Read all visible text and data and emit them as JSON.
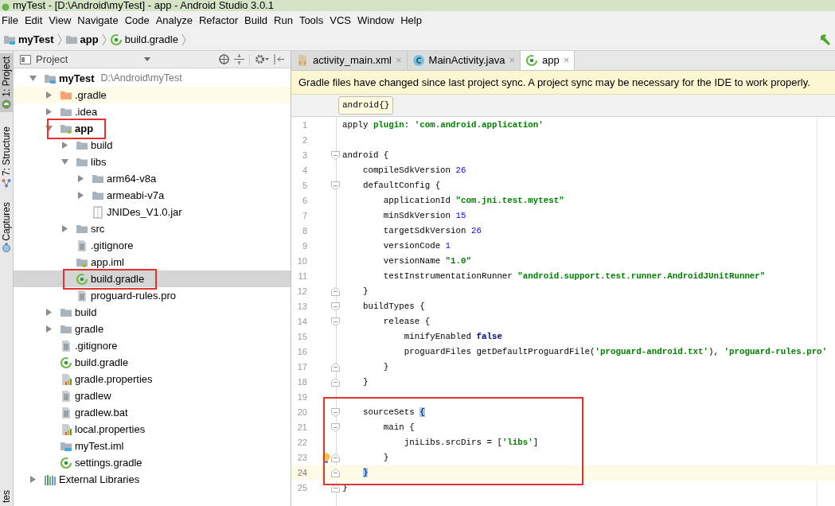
{
  "window": {
    "title": "myTest - [D:\\Android\\myTest] - app - Android Studio 3.0.1"
  },
  "menu": [
    "File",
    "Edit",
    "View",
    "Navigate",
    "Code",
    "Analyze",
    "Refactor",
    "Build",
    "Run",
    "Tools",
    "VCS",
    "Window",
    "Help"
  ],
  "breadcrumbs": [
    "myTest",
    "app",
    "build.gradle"
  ],
  "side_strip": [
    {
      "label": "1: Project",
      "selected": true
    },
    {
      "label": "7: Structure",
      "selected": false
    },
    {
      "label": "Captures",
      "selected": false
    },
    {
      "label": "tes",
      "selected": false
    }
  ],
  "project_panel": {
    "title": "Project",
    "tree": [
      {
        "name": "myTest",
        "hint": "D:\\Android\\myTest",
        "kind": "module",
        "bold": true,
        "expanded": true,
        "selected": false,
        "hovered": false,
        "highlighted": false,
        "children": [
          {
            "name": ".gradle",
            "kind": "folder-orange",
            "bold": false,
            "expanded": false,
            "selected": false,
            "hovered": true,
            "highlighted": false
          },
          {
            "name": ".idea",
            "kind": "folder",
            "bold": false,
            "expanded": false,
            "selected": false,
            "hovered": false,
            "highlighted": false
          },
          {
            "name": "app",
            "kind": "module-folder",
            "bold": true,
            "expanded": true,
            "selected": false,
            "hovered": false,
            "highlighted": true,
            "children": [
              {
                "name": "build",
                "kind": "folder",
                "bold": false,
                "expanded": false,
                "selected": false,
                "hovered": false,
                "highlighted": false
              },
              {
                "name": "libs",
                "kind": "folder",
                "bold": false,
                "expanded": true,
                "selected": false,
                "hovered": false,
                "highlighted": false,
                "children": [
                  {
                    "name": "arm64-v8a",
                    "kind": "folder",
                    "bold": false,
                    "expanded": false,
                    "selected": false,
                    "hovered": false,
                    "highlighted": false
                  },
                  {
                    "name": "armeabi-v7a",
                    "kind": "folder",
                    "bold": false,
                    "expanded": false,
                    "selected": false,
                    "hovered": false,
                    "highlighted": false
                  },
                  {
                    "name": "JNIDes_V1.0.jar",
                    "kind": "jar",
                    "bold": false,
                    "selected": false,
                    "hovered": false,
                    "highlighted": false
                  }
                ]
              },
              {
                "name": "src",
                "kind": "folder",
                "bold": false,
                "expanded": false,
                "selected": false,
                "hovered": false,
                "highlighted": false
              },
              {
                "name": ".gitignore",
                "kind": "text",
                "bold": false,
                "selected": false,
                "hovered": false,
                "highlighted": false
              },
              {
                "name": "app.iml",
                "kind": "iml-green",
                "bold": false,
                "selected": false,
                "hovered": false,
                "highlighted": false
              },
              {
                "name": "build.gradle",
                "kind": "gradle",
                "bold": false,
                "selected": true,
                "hovered": false,
                "highlighted": true
              },
              {
                "name": "proguard-rules.pro",
                "kind": "text",
                "bold": false,
                "selected": false,
                "hovered": false,
                "highlighted": false
              }
            ]
          },
          {
            "name": "build",
            "kind": "folder",
            "bold": false,
            "expanded": false,
            "selected": false,
            "hovered": false,
            "highlighted": false
          },
          {
            "name": "gradle",
            "kind": "folder",
            "bold": false,
            "expanded": false,
            "selected": false,
            "hovered": false,
            "highlighted": false
          },
          {
            "name": ".gitignore",
            "kind": "text",
            "bold": false,
            "selected": false,
            "hovered": false,
            "highlighted": false
          },
          {
            "name": "build.gradle",
            "kind": "gradle",
            "bold": false,
            "selected": false,
            "hovered": false,
            "highlighted": false
          },
          {
            "name": "gradle.properties",
            "kind": "properties",
            "bold": false,
            "selected": false,
            "hovered": false,
            "highlighted": false
          },
          {
            "name": "gradlew",
            "kind": "text",
            "bold": false,
            "selected": false,
            "hovered": false,
            "highlighted": false
          },
          {
            "name": "gradlew.bat",
            "kind": "text",
            "bold": false,
            "selected": false,
            "hovered": false,
            "highlighted": false
          },
          {
            "name": "local.properties",
            "kind": "properties",
            "bold": false,
            "selected": false,
            "hovered": false,
            "highlighted": false
          },
          {
            "name": "myTest.iml",
            "kind": "iml-blue",
            "bold": false,
            "selected": false,
            "hovered": false,
            "highlighted": false
          },
          {
            "name": "settings.gradle",
            "kind": "gradle",
            "bold": false,
            "selected": false,
            "hovered": false,
            "highlighted": false
          }
        ]
      },
      {
        "name": "External Libraries",
        "kind": "libraries",
        "bold": false,
        "expanded": false,
        "selected": false,
        "hovered": false,
        "highlighted": false
      }
    ]
  },
  "editor": {
    "tabs": [
      {
        "label": "activity_main.xml",
        "kind": "xml",
        "close": "×",
        "selected": false
      },
      {
        "label": "MainActivity.java",
        "kind": "class",
        "close": "×",
        "selected": false
      },
      {
        "label": "app",
        "kind": "gradle",
        "close": "×",
        "selected": true
      }
    ],
    "notification": "Gradle files have changed since last project sync. A project sync may be necessary for the IDE to work properly.",
    "crumb": "android{}",
    "lines": [
      {
        "number": "1",
        "fold_start": false,
        "fold_end": false,
        "boxed": false,
        "bulb": false,
        "current": false,
        "tokens": [
          {
            "text": "apply ",
            "kind": "plain"
          },
          {
            "text": "plugin",
            "kind": "key"
          },
          {
            "text": ": ",
            "kind": "plain"
          },
          {
            "text": "'com.android.application'",
            "kind": "string"
          }
        ]
      },
      {
        "number": "2",
        "fold_start": false,
        "fold_end": false,
        "boxed": false,
        "bulb": false,
        "current": false
      },
      {
        "number": "3",
        "fold_start": true,
        "fold_end": false,
        "boxed": false,
        "bulb": false,
        "current": false,
        "tokens": [
          {
            "text": "android {",
            "kind": "plain"
          }
        ]
      },
      {
        "number": "4",
        "fold_start": false,
        "fold_end": false,
        "boxed": false,
        "bulb": false,
        "current": false,
        "tokens": [
          {
            "text": "    compileSdkVersion ",
            "kind": "plain"
          },
          {
            "text": "26",
            "kind": "number"
          }
        ]
      },
      {
        "number": "5",
        "fold_start": true,
        "fold_end": false,
        "boxed": false,
        "bulb": false,
        "current": false,
        "tokens": [
          {
            "text": "    defaultConfig {",
            "kind": "plain"
          }
        ]
      },
      {
        "number": "6",
        "fold_start": false,
        "fold_end": false,
        "boxed": false,
        "bulb": false,
        "current": false,
        "tokens": [
          {
            "text": "        applicationId ",
            "kind": "plain"
          },
          {
            "text": "\"com.jni.test.mytest\"",
            "kind": "string"
          }
        ]
      },
      {
        "number": "7",
        "fold_start": false,
        "fold_end": false,
        "boxed": false,
        "bulb": false,
        "current": false,
        "tokens": [
          {
            "text": "        minSdkVersion ",
            "kind": "plain"
          },
          {
            "text": "15",
            "kind": "number"
          }
        ]
      },
      {
        "number": "8",
        "fold_start": false,
        "fold_end": false,
        "boxed": false,
        "bulb": false,
        "current": false,
        "tokens": [
          {
            "text": "        targetSdkVersion ",
            "kind": "plain"
          },
          {
            "text": "26",
            "kind": "number"
          }
        ]
      },
      {
        "number": "9",
        "fold_start": false,
        "fold_end": false,
        "boxed": false,
        "bulb": false,
        "current": false,
        "tokens": [
          {
            "text": "        versionCode ",
            "kind": "plain"
          },
          {
            "text": "1",
            "kind": "number"
          }
        ]
      },
      {
        "number": "10",
        "fold_start": false,
        "fold_end": false,
        "boxed": false,
        "bulb": false,
        "current": false,
        "tokens": [
          {
            "text": "        versionName ",
            "kind": "plain"
          },
          {
            "text": "\"1.0\"",
            "kind": "string"
          }
        ]
      },
      {
        "number": "11",
        "fold_start": false,
        "fold_end": false,
        "boxed": false,
        "bulb": false,
        "current": false,
        "tokens": [
          {
            "text": "        testInstrumentationRunner ",
            "kind": "plain"
          },
          {
            "text": "\"android.support.test.runner.AndroidJUnitRunner\"",
            "kind": "string"
          }
        ]
      },
      {
        "number": "12",
        "fold_start": false,
        "fold_end": true,
        "boxed": false,
        "bulb": false,
        "current": false,
        "tokens": [
          {
            "text": "    }",
            "kind": "plain"
          }
        ]
      },
      {
        "number": "13",
        "fold_start": true,
        "fold_end": false,
        "boxed": false,
        "bulb": false,
        "current": false,
        "tokens": [
          {
            "text": "    buildTypes {",
            "kind": "plain"
          }
        ]
      },
      {
        "number": "14",
        "fold_start": true,
        "fold_end": false,
        "boxed": false,
        "bulb": false,
        "current": false,
        "tokens": [
          {
            "text": "        release {",
            "kind": "plain"
          }
        ]
      },
      {
        "number": "15",
        "fold_start": false,
        "fold_end": false,
        "boxed": false,
        "bulb": false,
        "current": false,
        "tokens": [
          {
            "text": "            minifyEnabled ",
            "kind": "plain"
          },
          {
            "text": "false",
            "kind": "keyword"
          }
        ]
      },
      {
        "number": "16",
        "fold_start": false,
        "fold_end": false,
        "boxed": false,
        "bulb": false,
        "current": false,
        "tokens": [
          {
            "text": "            proguardFiles getDefaultProguardFile(",
            "kind": "plain"
          },
          {
            "text": "'proguard-android.txt'",
            "kind": "string"
          },
          {
            "text": "), ",
            "kind": "plain"
          },
          {
            "text": "'proguard-rules.pro'",
            "kind": "string"
          }
        ]
      },
      {
        "number": "17",
        "fold_start": false,
        "fold_end": true,
        "boxed": false,
        "bulb": false,
        "current": false,
        "tokens": [
          {
            "text": "        }",
            "kind": "plain"
          }
        ]
      },
      {
        "number": "18",
        "fold_start": false,
        "fold_end": true,
        "boxed": false,
        "bulb": false,
        "current": false,
        "tokens": [
          {
            "text": "    }",
            "kind": "plain"
          }
        ]
      },
      {
        "number": "19",
        "fold_start": false,
        "fold_end": false,
        "boxed": false,
        "bulb": false,
        "current": false
      },
      {
        "number": "20",
        "fold_start": true,
        "fold_end": false,
        "boxed": true,
        "bulb": false,
        "current": false,
        "tokens": [
          {
            "text": "    sourceSets ",
            "kind": "plain"
          },
          {
            "text": "{",
            "kind": "brace"
          }
        ]
      },
      {
        "number": "21",
        "fold_start": true,
        "fold_end": false,
        "boxed": true,
        "bulb": false,
        "current": false,
        "tokens": [
          {
            "text": "        main {",
            "kind": "plain"
          }
        ]
      },
      {
        "number": "22",
        "fold_start": false,
        "fold_end": false,
        "boxed": true,
        "bulb": false,
        "current": false,
        "tokens": [
          {
            "text": "            jniLibs.srcDirs = [",
            "kind": "plain"
          },
          {
            "text": "'libs'",
            "kind": "string"
          },
          {
            "text": "]",
            "kind": "plain"
          }
        ]
      },
      {
        "number": "23",
        "fold_start": false,
        "fold_end": true,
        "boxed": true,
        "bulb": true,
        "current": false,
        "tokens": [
          {
            "text": "        }",
            "kind": "plain"
          }
        ]
      },
      {
        "number": "24",
        "fold_start": false,
        "fold_end": true,
        "boxed": true,
        "bulb": false,
        "current": true,
        "tokens": [
          {
            "text": "    }",
            "kind": "brace"
          }
        ]
      },
      {
        "number": "25",
        "fold_start": false,
        "fold_end": true,
        "boxed": false,
        "bulb": false,
        "current": false,
        "tokens": [
          {
            "text": "}",
            "kind": "plain"
          }
        ]
      }
    ]
  }
}
